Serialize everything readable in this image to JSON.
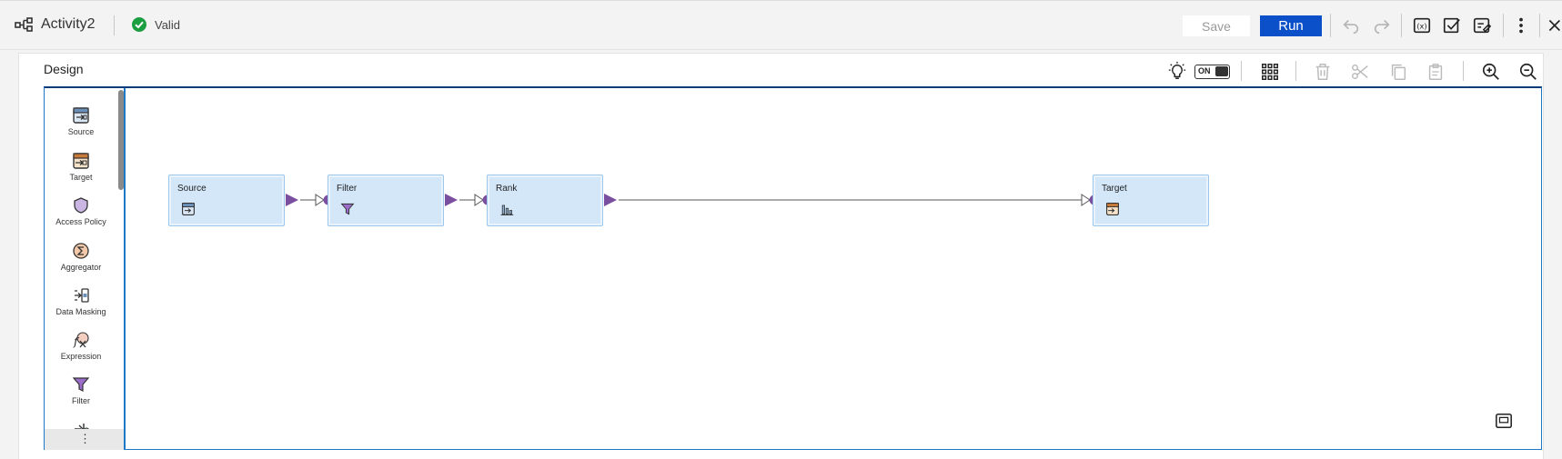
{
  "header": {
    "title": "Activity2",
    "status": "Valid",
    "save_label": "Save",
    "run_label": "Run"
  },
  "toolbar_icons": [
    "undo-icon",
    "redo-icon",
    "parameters-icon",
    "validate-icon",
    "properties-icon",
    "more-icon",
    "close-icon"
  ],
  "design": {
    "label": "Design",
    "smart_match_toggle": "ON",
    "canvas_tools": [
      "arrange-all-icon",
      "delete-icon",
      "cut-icon",
      "copy-icon",
      "paste-icon",
      "zoom-in-icon",
      "zoom-out-icon"
    ]
  },
  "palette": {
    "items": [
      {
        "label": "Source",
        "icon": "source-icon"
      },
      {
        "label": "Target",
        "icon": "target-icon"
      },
      {
        "label": "Access Policy",
        "icon": "shield-icon"
      },
      {
        "label": "Aggregator",
        "icon": "sigma-icon"
      },
      {
        "label": "Data Masking",
        "icon": "masking-icon"
      },
      {
        "label": "Expression",
        "icon": "function-icon"
      },
      {
        "label": "Filter",
        "icon": "filter-icon"
      }
    ],
    "more": "⋮"
  },
  "nodes": [
    {
      "label": "Source",
      "icon": "source-icon"
    },
    {
      "label": "Filter",
      "icon": "filter-icon"
    },
    {
      "label": "Rank",
      "icon": "rank-icon"
    },
    {
      "label": "Target",
      "icon": "target-icon"
    }
  ],
  "colors": {
    "run_button": "#0b50c9",
    "node_fill": "#d3e7f9",
    "port": "#7b4fa0",
    "valid": "#1a9e3f"
  }
}
